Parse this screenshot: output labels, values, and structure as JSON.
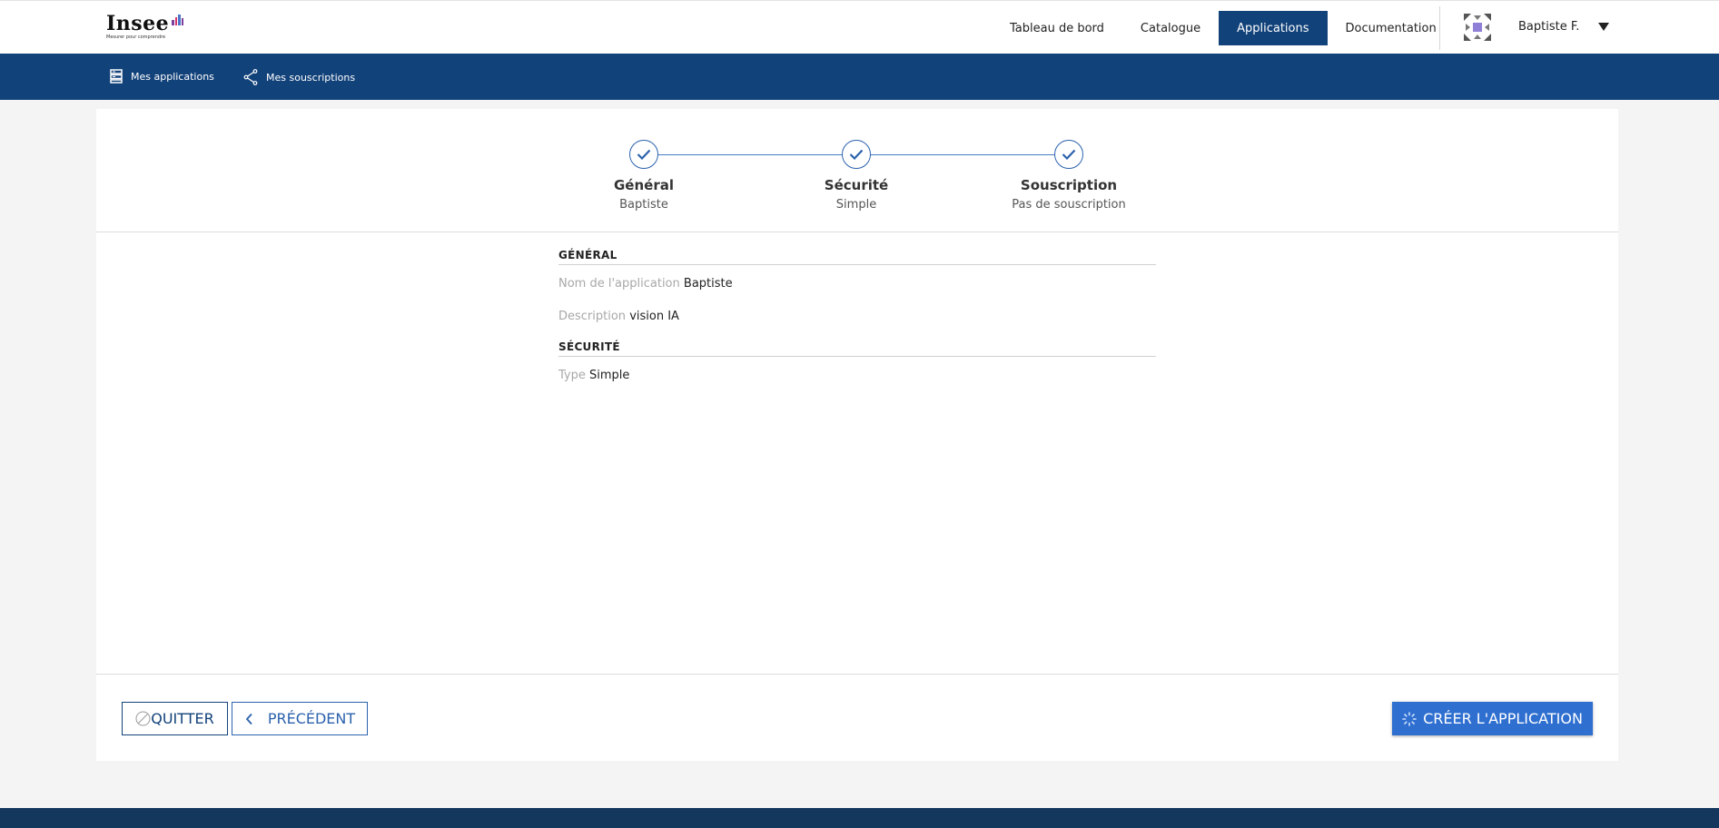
{
  "header": {
    "logo_text": "Insee",
    "logo_tagline": "Mesurer pour comprendre",
    "nav": [
      {
        "label": "Tableau de bord",
        "active": false
      },
      {
        "label": "Catalogue",
        "active": false
      },
      {
        "label": "Applications",
        "active": true
      },
      {
        "label": "Documentation",
        "active": false
      }
    ],
    "user_name": "Baptiste F.",
    "avatar_icon": "identicon-avatar",
    "caret_icon": "caret-down-icon"
  },
  "subnav": {
    "items": [
      {
        "label": "Mes applications",
        "icon": "applications-icon"
      },
      {
        "label": "Mes souscriptions",
        "icon": "share-icon"
      }
    ]
  },
  "stepper": {
    "steps": [
      {
        "title": "Général",
        "subtitle": "Baptiste",
        "done": true
      },
      {
        "title": "Sécurité",
        "subtitle": "Simple",
        "done": true
      },
      {
        "title": "Souscription",
        "subtitle": "Pas de souscription",
        "done": true
      }
    ]
  },
  "summary": {
    "general": {
      "title": "GÉNÉRAL",
      "name_label": "Nom de l'application",
      "name_value": "Baptiste",
      "description_label": "Description",
      "description_value": "vision IA"
    },
    "security": {
      "title": "SÉCURITÉ",
      "type_label": "Type",
      "type_value": "Simple"
    }
  },
  "actions": {
    "quit_label": "QUITTER",
    "prev_label": "PRÉCÉDENT",
    "create_label": "CRÉER L'APPLICATION"
  },
  "colors": {
    "brand_navy": "#12427a",
    "primary_blue": "#2e6fd0",
    "footer": "#14375e"
  }
}
